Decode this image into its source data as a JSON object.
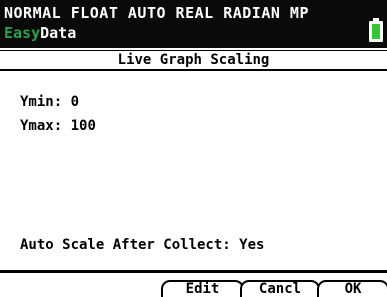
{
  "status": {
    "mode_line": "NORMAL FLOAT AUTO REAL RADIAN MP",
    "app_prefix": "Easy",
    "app_name": "Data"
  },
  "screen": {
    "title": "Live Graph Scaling",
    "ymin_label": "Ymin:",
    "ymin_value": "0",
    "ymax_label": "Ymax:",
    "ymax_value": "100",
    "auto_scale_label": "Auto Scale After Collect:",
    "auto_scale_value": "Yes"
  },
  "softkeys": {
    "edit": "Edit",
    "cancel": "Cancl",
    "ok": "OK"
  },
  "colors": {
    "status_bg": "#0a0a0a",
    "app_prefix": "#27a24a",
    "battery": "#32c832"
  }
}
